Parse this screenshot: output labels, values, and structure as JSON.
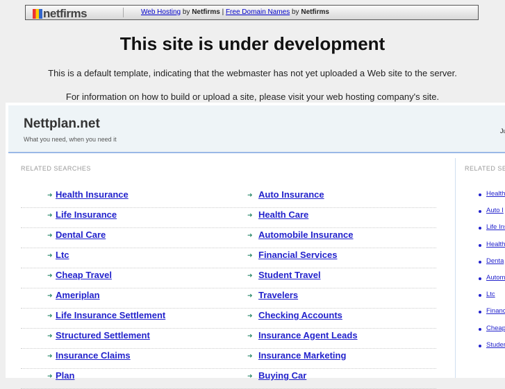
{
  "topbar": {
    "logo": "netfirms",
    "link1": "Web Hosting",
    "by1": "by",
    "brand1": "Netfirms",
    "sep": "|",
    "link2": "Free Domain Names",
    "by2": "by",
    "brand2": "Netfirms"
  },
  "title": "This site is under development",
  "para1": "This is a default template, indicating that the webmaster has not yet uploaded a Web site to the server.",
  "para2": "For information on how to build or upload a site, please visit your web hosting company's site.",
  "site": {
    "name": "Nettplan.net",
    "tagline": "What you need, when you need it",
    "right_text": "Ju"
  },
  "related_label": "RELATED SEARCHES",
  "related_label_right": "RELATED SE",
  "rows": [
    [
      "Health Insurance",
      "Auto Insurance"
    ],
    [
      "Life Insurance",
      "Health Care"
    ],
    [
      "Dental Care",
      "Automobile Insurance"
    ],
    [
      "Ltc",
      "Financial Services"
    ],
    [
      "Cheap Travel",
      "Student Travel"
    ],
    [
      "Ameriplan",
      "Travelers"
    ],
    [
      "Life Insurance Settlement",
      "Checking Accounts"
    ],
    [
      "Structured Settlement",
      "Insurance Agent Leads"
    ],
    [
      "Insurance Claims",
      "Insurance Marketing"
    ],
    [
      "Plan",
      "Buying Car"
    ]
  ],
  "right_items": [
    "Health",
    "Auto I",
    "Life Ins",
    "Health",
    "Denta",
    "Autom",
    "Ltc",
    "Financ",
    "Cheap",
    "Studer"
  ]
}
